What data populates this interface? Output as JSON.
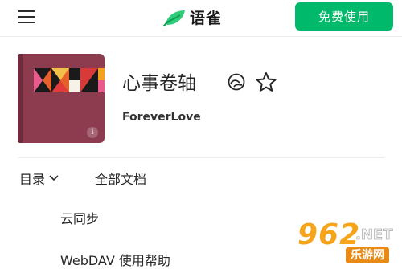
{
  "header": {
    "brand_name": "语雀",
    "free_button_label": "免费使用"
  },
  "book": {
    "title": "心事卷轴",
    "owner": "ForeverLove",
    "cover_info_glyph": "i"
  },
  "tabs": {
    "catalog_label": "目录",
    "all_docs_label": "全部文档"
  },
  "toc": {
    "items": [
      "云同步",
      "WebDAV 使用帮助"
    ]
  },
  "watermark": {
    "number": "962",
    "suffix": ".NET",
    "site_name": "乐游网"
  },
  "colors": {
    "accent": "#00b96b",
    "cover": "#8d3b4f"
  }
}
